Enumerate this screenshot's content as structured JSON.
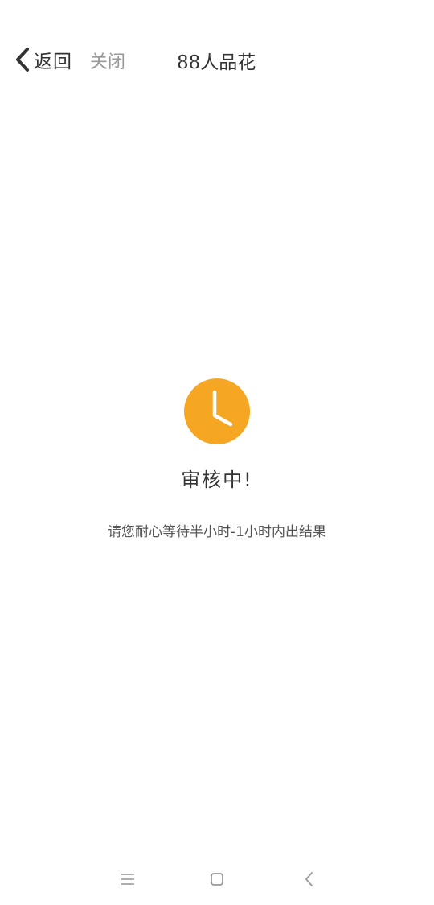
{
  "nav": {
    "back_label": "返回",
    "close_label": "关闭",
    "title": "88人品花"
  },
  "status": {
    "icon": "clock-icon",
    "icon_color": "#F5A623",
    "title": "审核中!",
    "message": "请您耐心等待半小时-1小时内出结果"
  },
  "system_nav": {
    "items": [
      "menu-icon",
      "home-icon",
      "back-icon"
    ]
  }
}
